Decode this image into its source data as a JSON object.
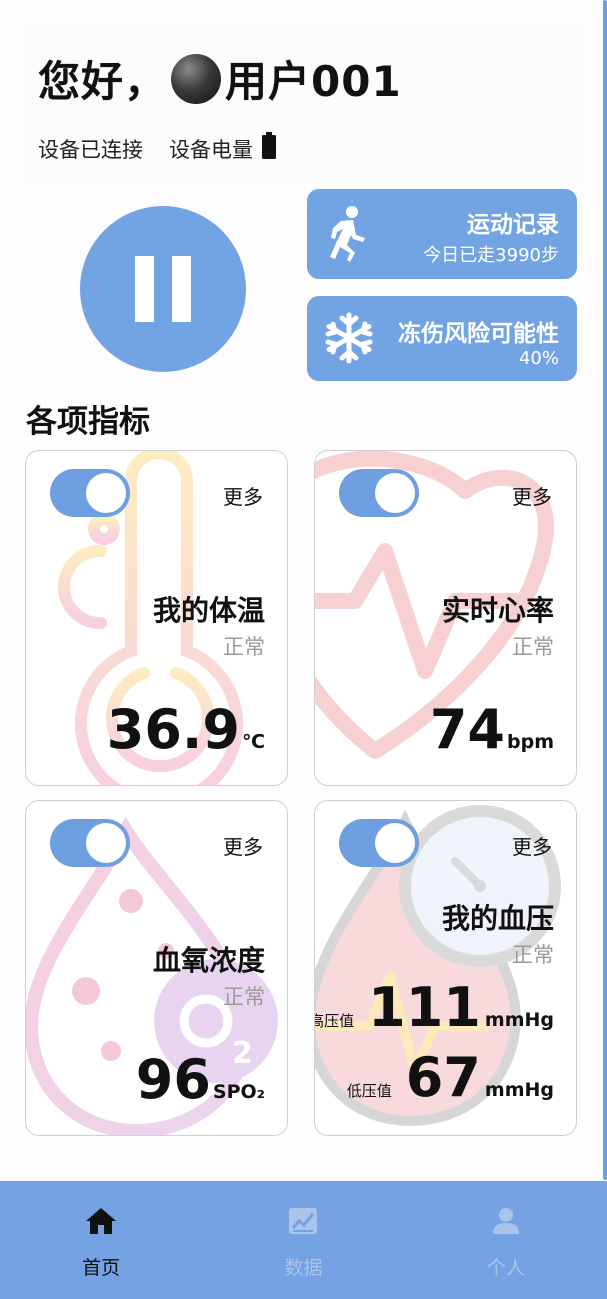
{
  "header": {
    "greeting": "您好，",
    "username": "用户001",
    "connection_status": "设备已连接",
    "battery_label": "设备电量"
  },
  "actions": {
    "exercise": {
      "title": "运动记录",
      "subtitle": "今日已走3990步",
      "icon": "running-person-icon"
    },
    "frostbite": {
      "title": "冻伤风险可能性",
      "value": "40%",
      "icon": "snowflake-icon"
    }
  },
  "section_title": "各项指标",
  "metrics": {
    "temperature": {
      "title": "我的体温",
      "status": "正常",
      "value": "36.9",
      "unit": "℃",
      "more": "更多",
      "enabled": true
    },
    "heart_rate": {
      "title": "实时心率",
      "status": "正常",
      "value": "74",
      "unit": "bpm",
      "more": "更多",
      "enabled": true
    },
    "spo2": {
      "title": "血氧浓度",
      "status": "正常",
      "value": "96",
      "unit": "SPO₂",
      "more": "更多",
      "enabled": true
    },
    "blood_pressure": {
      "title": "我的血压",
      "status": "正常",
      "more": "更多",
      "enabled": true,
      "high_label": "高压值",
      "high_value": "111",
      "low_label": "低压值",
      "low_value": "67",
      "unit": "mmHg"
    }
  },
  "nav": {
    "items": [
      {
        "label": "首页",
        "icon": "home-icon",
        "active": true
      },
      {
        "label": "数据",
        "icon": "chart-icon",
        "active": false
      },
      {
        "label": "个人",
        "icon": "person-icon",
        "active": false
      }
    ]
  },
  "colors": {
    "accent": "#72a3e2",
    "status_gray": "#9a9a9a"
  }
}
